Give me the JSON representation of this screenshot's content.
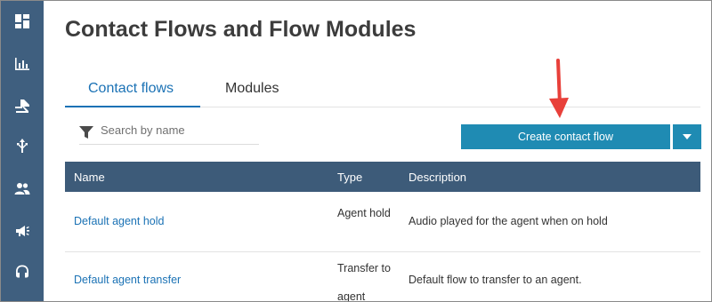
{
  "page": {
    "title": "Contact Flows and Flow Modules"
  },
  "sidebar": {
    "icons": [
      "dashboard-icon",
      "metrics-icon",
      "routing-icon",
      "flows-icon",
      "users-icon",
      "campaigns-icon",
      "headset-icon"
    ]
  },
  "tabs": [
    {
      "label": "Contact flows",
      "active": true
    },
    {
      "label": "Modules",
      "active": false
    }
  ],
  "search": {
    "placeholder": "Search by name"
  },
  "actions": {
    "create_label": "Create contact flow"
  },
  "table": {
    "columns": [
      "Name",
      "Type",
      "Description"
    ],
    "rows": [
      {
        "name": "Default agent hold",
        "type": "Agent hold",
        "description": "Audio played for the agent when on hold"
      },
      {
        "name": "Default agent transfer",
        "type": "Transfer to agent",
        "description": "Default flow to transfer to an agent."
      }
    ]
  },
  "colors": {
    "sidebar": "#3f5f7f",
    "accent": "#1b72b5",
    "button": "#1f8bb3",
    "table_header": "#3d5b79",
    "annotation_arrow": "#e8403a"
  }
}
